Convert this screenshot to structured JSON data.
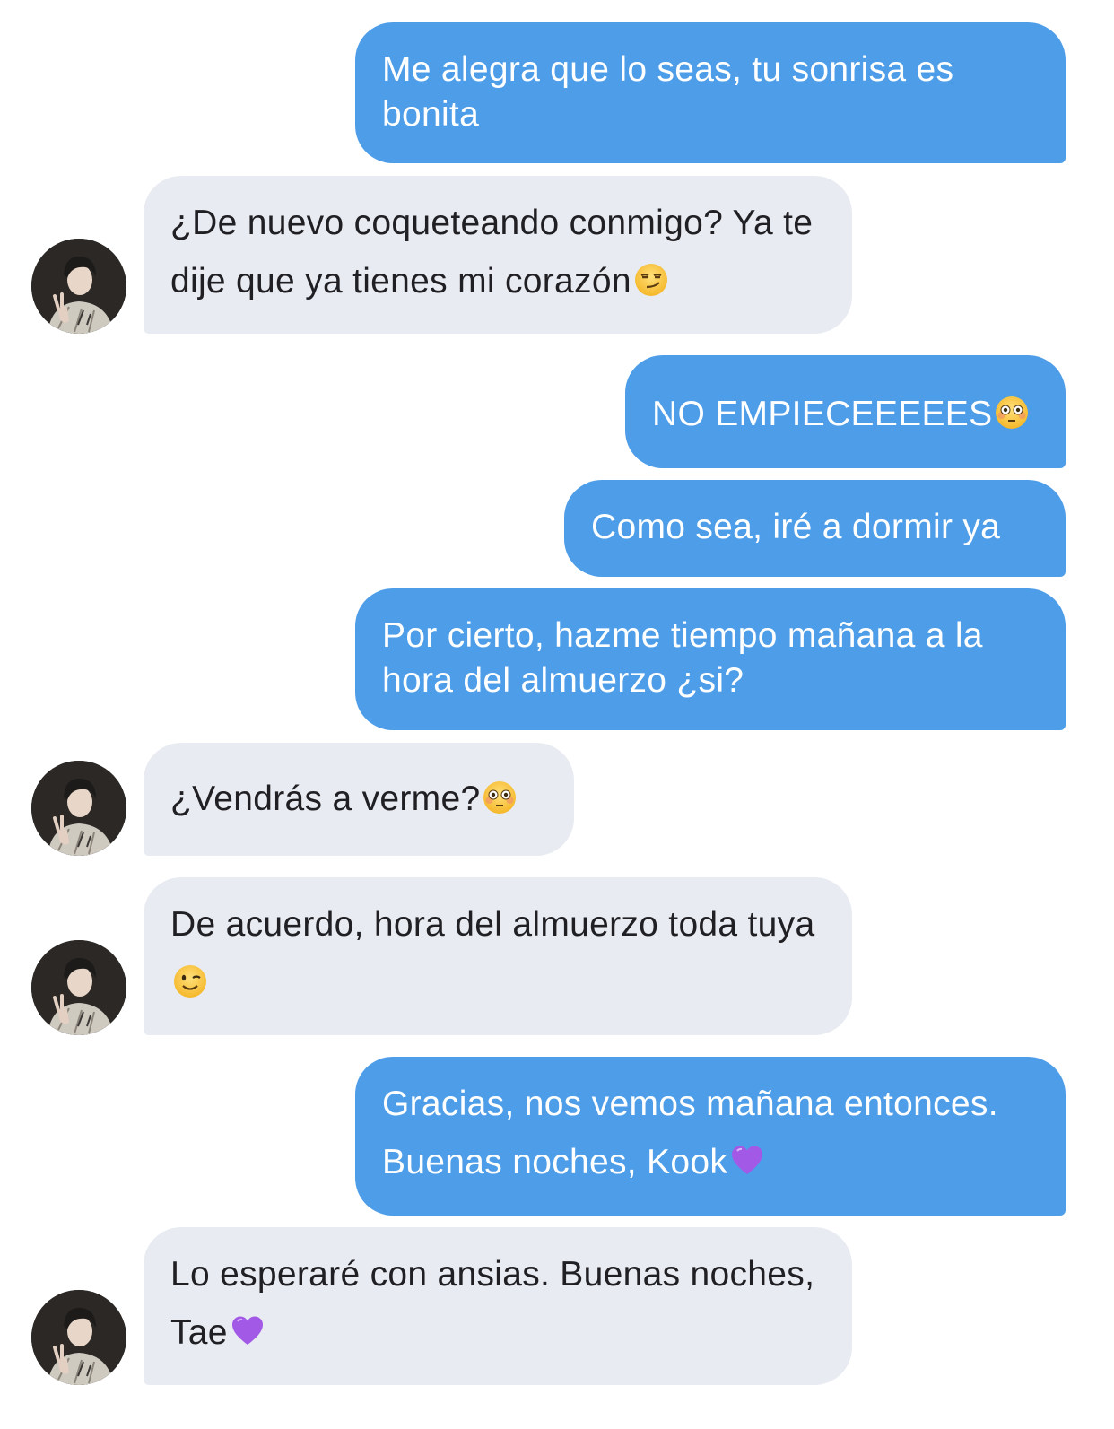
{
  "messages": [
    {
      "id": "m1",
      "side": "sent",
      "text": "Me alegra que lo seas, tu sonrisa es bonita",
      "emoji": null
    },
    {
      "id": "m2",
      "side": "received",
      "text": "¿De nuevo coqueteando conmigo? Ya te dije que ya tienes mi corazón",
      "emoji": "smirking-face-icon"
    },
    {
      "id": "m3",
      "side": "sent",
      "text": "NO EMPIECEEEEES",
      "emoji": "flushed-face-icon"
    },
    {
      "id": "m4",
      "side": "sent",
      "text": "Como sea, iré a dormir ya",
      "emoji": null
    },
    {
      "id": "m5",
      "side": "sent",
      "text": "Por cierto, hazme tiempo mañana a la hora del almuerzo ¿si?",
      "emoji": null
    },
    {
      "id": "m6",
      "side": "received",
      "text": "¿Vendrás a verme?",
      "emoji": "flushed-face-icon"
    },
    {
      "id": "m7",
      "side": "received",
      "text": "De acuerdo, hora del almuerzo toda tuya",
      "emoji": "winking-face-icon"
    },
    {
      "id": "m8",
      "side": "sent",
      "text": "Gracias, nos vemos mañana entonces. Buenas noches, Kook",
      "emoji": "purple-heart-icon"
    },
    {
      "id": "m9",
      "side": "received",
      "text": "Lo esperaré con ansias. Buenas noches, Tae",
      "emoji": "purple-heart-icon"
    }
  ],
  "colors": {
    "sent_bubble": "#4d9de8",
    "received_bubble": "#e8ebf1",
    "sent_text": "#ffffff",
    "received_text": "#1f1f24",
    "background": "#ffffff"
  }
}
